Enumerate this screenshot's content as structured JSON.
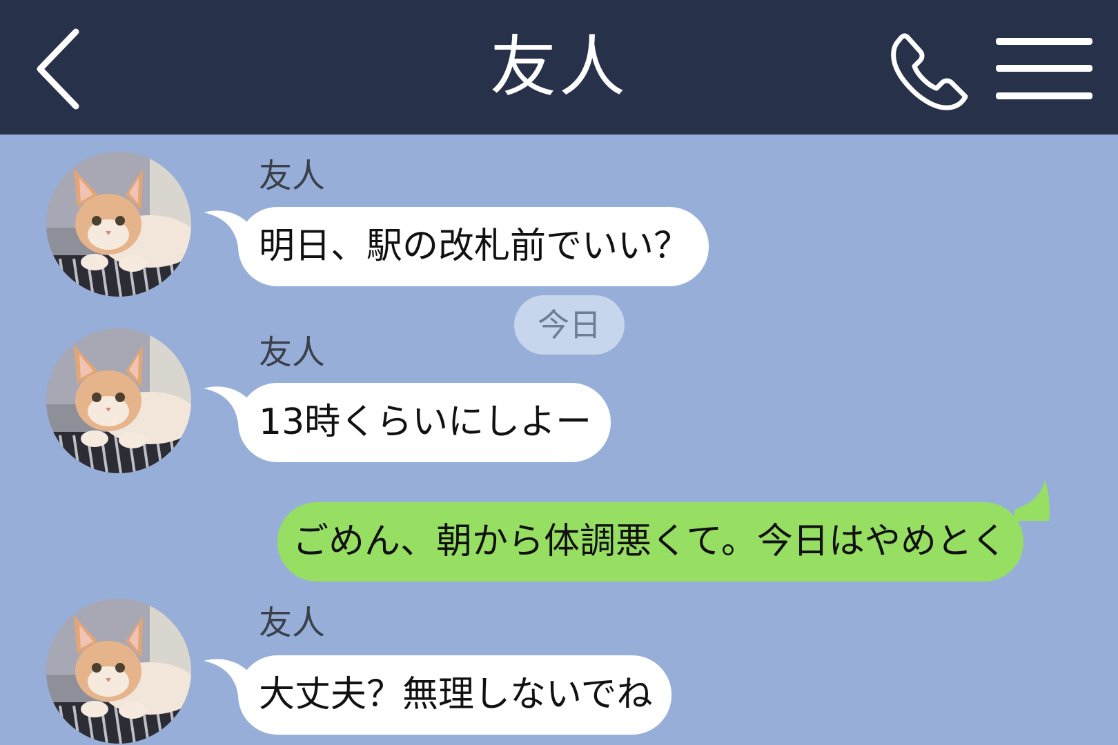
{
  "header": {
    "back_icon": "chevron-left-icon",
    "title": "友人",
    "call_icon": "phone-icon",
    "menu_icon": "hamburger-menu-icon",
    "background_color": "#28314a"
  },
  "chat": {
    "background_color": "#97afd8",
    "date_separator": "今日",
    "messages": [
      {
        "direction": "incoming",
        "sender": "友人",
        "text": "明日、駅の改札前でいい？",
        "avatar": "cat-avatar"
      },
      {
        "direction": "incoming",
        "sender": "友人",
        "text": "13時くらいにしよー",
        "avatar": "cat-avatar"
      },
      {
        "direction": "outgoing",
        "text": "ごめん、朝から体調悪くて。今日はやめとく"
      },
      {
        "direction": "incoming",
        "sender": "友人",
        "text": "大丈夫？無理しないでね",
        "avatar": "cat-avatar"
      }
    ]
  },
  "colors": {
    "incoming_bubble": "#ffffff",
    "outgoing_bubble": "#97df63",
    "date_chip": "#c7d5ed"
  }
}
